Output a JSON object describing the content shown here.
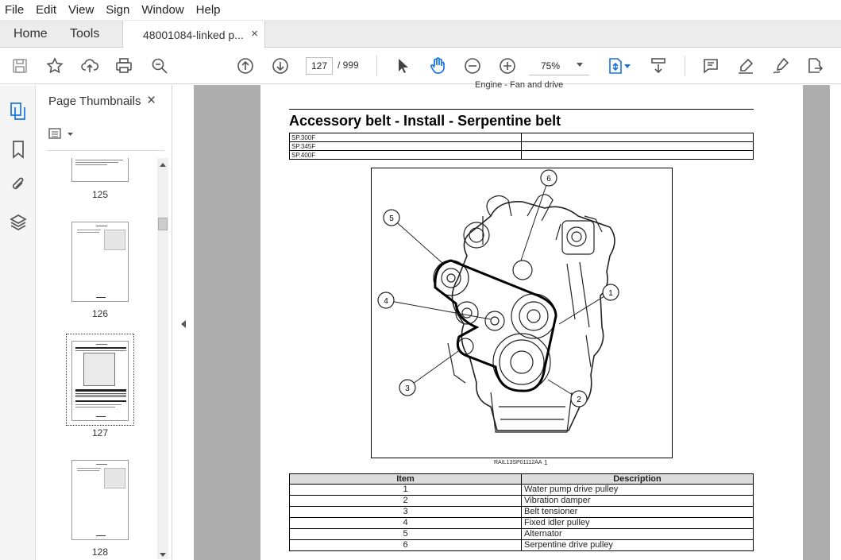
{
  "menu": [
    "File",
    "Edit",
    "View",
    "Sign",
    "Window",
    "Help"
  ],
  "tabs": {
    "home": "Home",
    "tools": "Tools",
    "document": "48001084-linked p...",
    "close_glyph": "×"
  },
  "toolbar": {
    "current_page": "127",
    "total_pages": "/ 999",
    "zoom": "75%",
    "icons": [
      "save-icon",
      "star-icon",
      "upload-icon",
      "print-icon",
      "zoom-search-icon",
      "page-up-icon",
      "page-down-icon",
      "select-arrow-icon",
      "hand-icon",
      "zoom-out-icon",
      "zoom-in-icon",
      "fit-page-icon",
      "scroll-mode-icon",
      "comment-icon",
      "highlight-icon",
      "sign-icon",
      "export-icon"
    ]
  },
  "sidebar": {
    "title": "Page Thumbnails",
    "close_glyph": "×",
    "thumbnails": [
      {
        "page": "125"
      },
      {
        "page": "126"
      },
      {
        "page": "127",
        "selected": true
      },
      {
        "page": "128"
      }
    ]
  },
  "document": {
    "header_fragment": "Engine - Fan and drive",
    "title": "Accessory belt - Install - Serpentine belt",
    "models": [
      "SP.300F",
      "SP.345F",
      "SP.400F"
    ],
    "figure": {
      "callouts": [
        "1",
        "2",
        "3",
        "4",
        "5",
        "6"
      ],
      "caption": "RAIL13SP01112AA",
      "number": "1"
    },
    "items_table": {
      "headers": [
        "Item",
        "Description"
      ],
      "rows": [
        [
          "1",
          "Water pump drive pulley"
        ],
        [
          "2",
          "Vibration damper"
        ],
        [
          "3",
          "Belt tensioner"
        ],
        [
          "4",
          "Fixed idler pulley"
        ],
        [
          "5",
          "Alternator"
        ],
        [
          "6",
          "Serpentine drive pulley"
        ]
      ]
    }
  }
}
